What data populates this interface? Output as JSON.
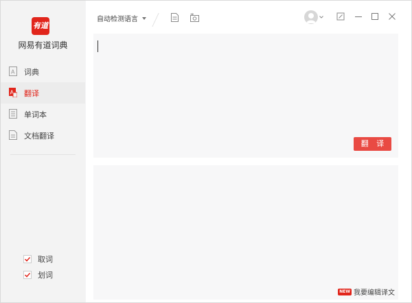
{
  "app": {
    "logo_text": "有道",
    "title": "网易有道词典"
  },
  "sidebar": {
    "items": [
      {
        "label": "词典",
        "icon": "dictionary-icon",
        "active": false
      },
      {
        "label": "翻译",
        "icon": "translate-icon",
        "active": true
      },
      {
        "label": "单词本",
        "icon": "wordbook-icon",
        "active": false
      },
      {
        "label": "文档翻译",
        "icon": "document-icon",
        "active": false
      }
    ],
    "options": [
      {
        "label": "取词",
        "checked": true
      },
      {
        "label": "划词",
        "checked": true
      }
    ]
  },
  "toolbar": {
    "language_selected": "自动检测语言",
    "icons": [
      "document-icon",
      "screenshot-icon"
    ]
  },
  "window_controls": [
    "user-avatar",
    "mini-mode-icon",
    "minimize-icon",
    "maximize-icon",
    "close-icon"
  ],
  "translate": {
    "input_value": "",
    "button_label": "翻 译",
    "output_value": "",
    "edit_badge": "NEW",
    "edit_link": "我要编辑译文"
  },
  "colors": {
    "accent": "#e1251b",
    "button": "#e94a43",
    "panel": "#f7f7f8",
    "sidebar": "#f3f3f3"
  }
}
